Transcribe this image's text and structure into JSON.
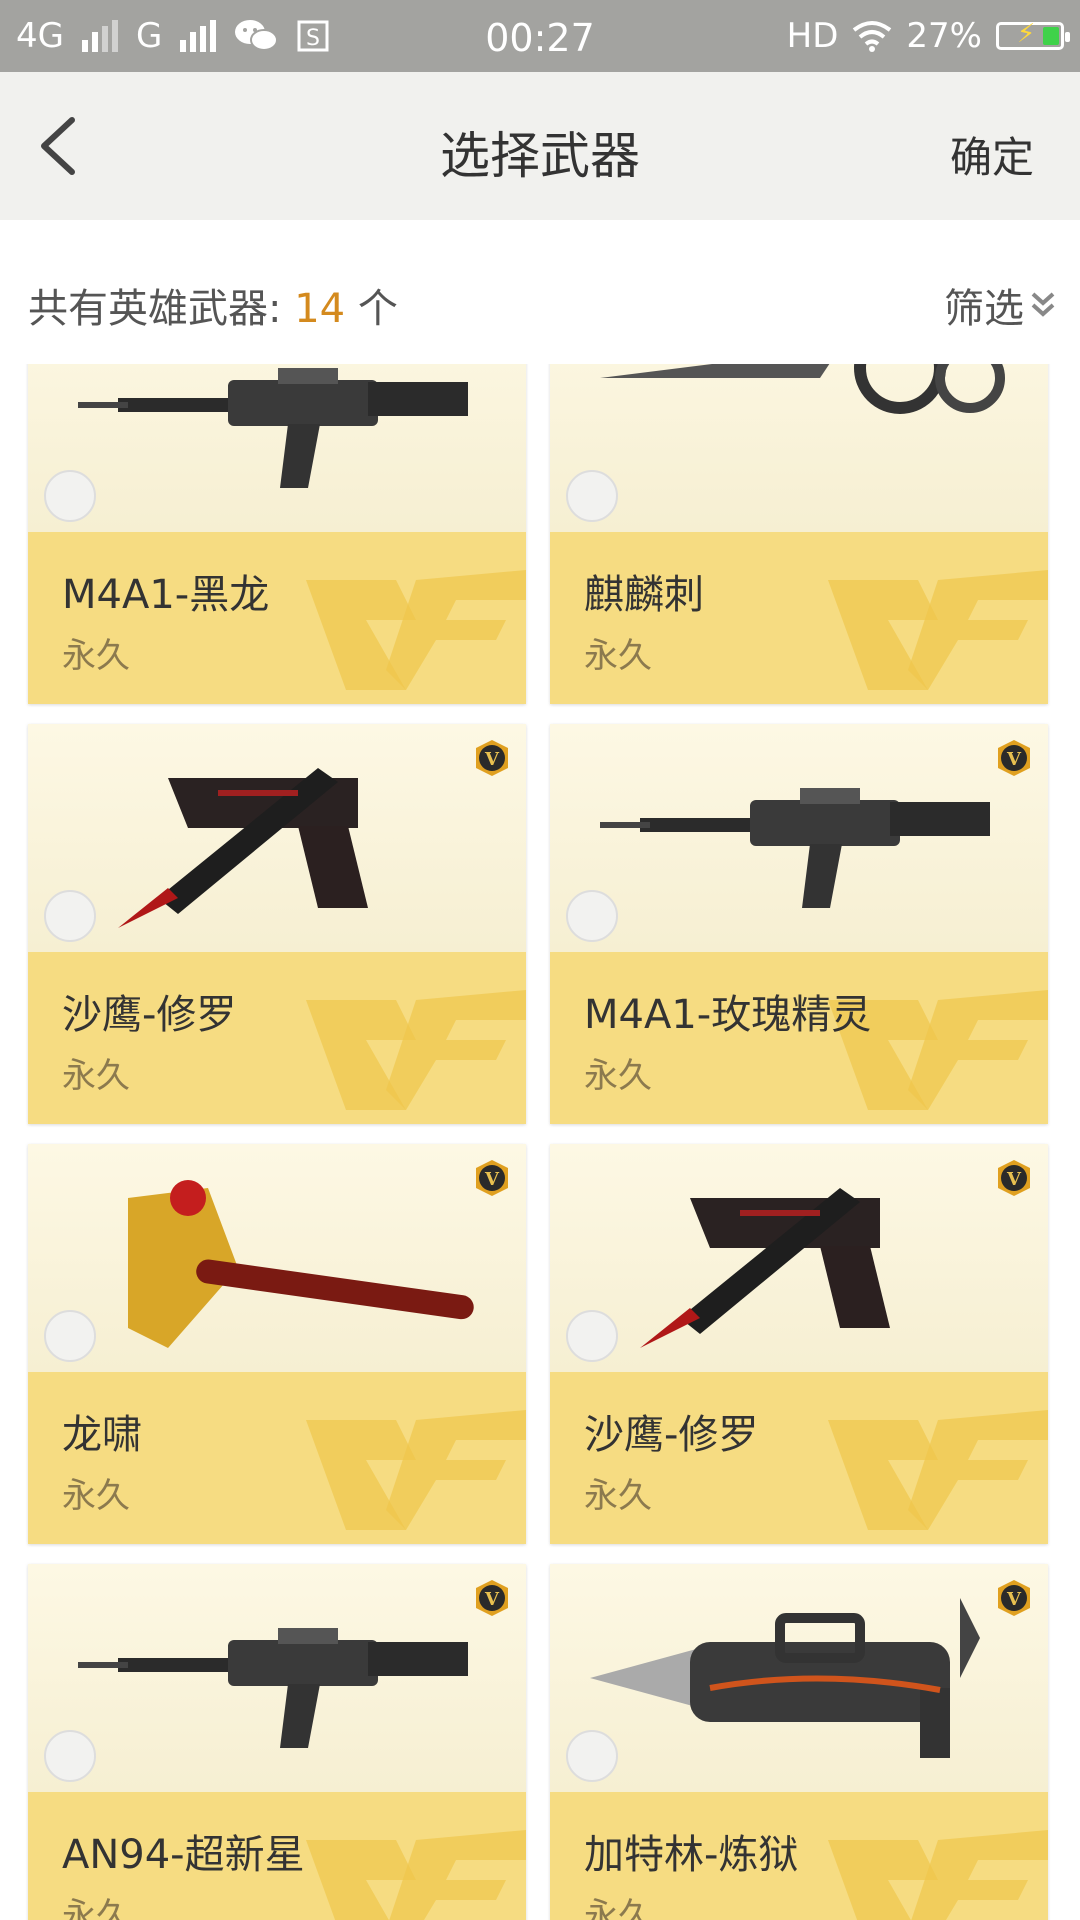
{
  "status": {
    "network1": "4G",
    "network2": "G",
    "time": "00:27",
    "hd": "HD",
    "battery": "27%"
  },
  "header": {
    "title": "选择武器",
    "confirm": "确定"
  },
  "summary": {
    "prefix": "共有英雄武器:",
    "count": "14",
    "unit": "个",
    "filter": "筛选"
  },
  "weapons": [
    {
      "name": "M4A1-黑龙",
      "duration": "永久",
      "vip": false,
      "icon": "rifle-icon"
    },
    {
      "name": "麒麟刺",
      "duration": "永久",
      "vip": false,
      "icon": "blade-icon"
    },
    {
      "name": "沙鹰-修罗",
      "duration": "永久",
      "vip": true,
      "icon": "pistol-icon"
    },
    {
      "name": "M4A1-玫瑰精灵",
      "duration": "永久",
      "vip": true,
      "icon": "rifle-icon"
    },
    {
      "name": "龙啸",
      "duration": "永久",
      "vip": true,
      "icon": "axe-icon"
    },
    {
      "name": "沙鹰-修罗",
      "duration": "永久",
      "vip": true,
      "icon": "pistol-icon"
    },
    {
      "name": "AN94-超新星",
      "duration": "永久",
      "vip": true,
      "icon": "rifle-icon"
    },
    {
      "name": "加特林-炼狱",
      "duration": "永久",
      "vip": true,
      "icon": "gatling-icon"
    }
  ],
  "colors": {
    "statusbar": "#a3a3a0",
    "header_bg": "#f1f1ee",
    "card_info": "#f6dc82",
    "card_image_bg": "#fbf5d9",
    "accent_count": "#d48a1e"
  }
}
